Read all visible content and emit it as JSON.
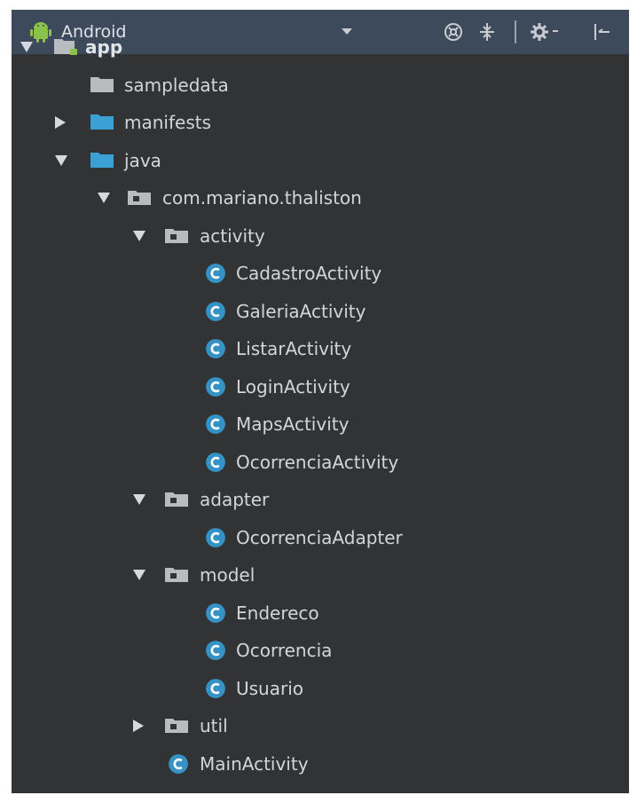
{
  "toolbar": {
    "view_label": "Android",
    "icons": [
      "sync-scroll-icon",
      "collapse-all-icon",
      "settings-icon",
      "hide-panel-icon"
    ]
  },
  "colors": {
    "toolbar_bg": "#3c4a5c",
    "panel_bg": "#313335",
    "folder_blue": "#3aa0d6",
    "folder_gray": "#b9bcbf",
    "class_icon": "#3592c4",
    "android_green": "#8bc34a"
  },
  "tree": {
    "items": [
      {
        "label": "app",
        "icon": "module-folder-icon",
        "state": "expanded"
      },
      {
        "label": "sampledata",
        "icon": "gray-folder-icon",
        "state": "none"
      },
      {
        "label": "manifests",
        "icon": "blue-folder-icon",
        "state": "collapsed"
      },
      {
        "label": "java",
        "icon": "blue-folder-icon",
        "state": "expanded"
      },
      {
        "label": "com.mariano.thaliston",
        "icon": "package-icon",
        "state": "expanded"
      },
      {
        "label": "activity",
        "icon": "package-icon",
        "state": "expanded"
      },
      {
        "label": "CadastroActivity",
        "icon": "class-icon",
        "state": "none"
      },
      {
        "label": "GaleriaActivity",
        "icon": "class-icon",
        "state": "none"
      },
      {
        "label": "ListarActivity",
        "icon": "class-icon",
        "state": "none"
      },
      {
        "label": "LoginActivity",
        "icon": "class-icon",
        "state": "none"
      },
      {
        "label": "MapsActivity",
        "icon": "class-icon",
        "state": "none"
      },
      {
        "label": "OcorrenciaActivity",
        "icon": "class-icon",
        "state": "none"
      },
      {
        "label": "adapter",
        "icon": "package-icon",
        "state": "expanded"
      },
      {
        "label": "OcorrenciaAdapter",
        "icon": "class-icon",
        "state": "none"
      },
      {
        "label": "model",
        "icon": "package-icon",
        "state": "expanded"
      },
      {
        "label": "Endereco",
        "icon": "class-icon",
        "state": "none"
      },
      {
        "label": "Ocorrencia",
        "icon": "class-icon",
        "state": "none"
      },
      {
        "label": "Usuario",
        "icon": "class-icon",
        "state": "none"
      },
      {
        "label": "util",
        "icon": "package-icon",
        "state": "collapsed"
      },
      {
        "label": "MainActivity",
        "icon": "class-icon",
        "state": "none"
      }
    ]
  }
}
